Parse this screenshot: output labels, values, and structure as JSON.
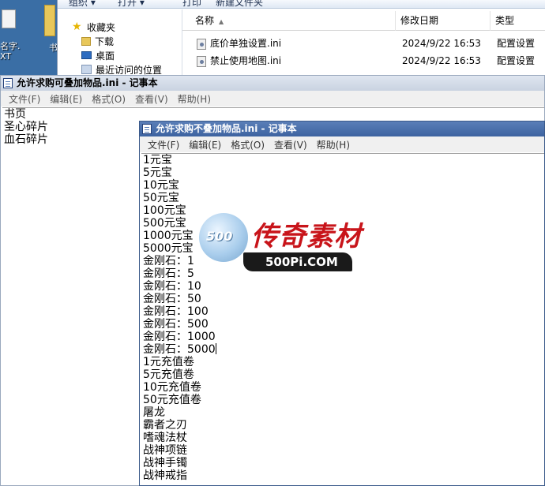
{
  "desktop": {
    "icon_label_line1": "名字.",
    "icon_label_line2": "XT",
    "folder_label": "书"
  },
  "explorer": {
    "toolbar": {
      "organize": "组织 ▾",
      "open": "打开 ▾",
      "print": "打印",
      "new_folder": "新建文件夹"
    },
    "nav": [
      {
        "label": "收藏夹",
        "icon": "star-icon"
      },
      {
        "label": "下载",
        "icon": "download-folder-icon"
      },
      {
        "label": "桌面",
        "icon": "desktop-icon"
      },
      {
        "label": "最近访问的位置",
        "icon": "recent-places-icon"
      }
    ],
    "columns": {
      "name": "名称",
      "date": "修改日期",
      "type": "类型"
    },
    "files": [
      {
        "name": "底价单独设置.ini",
        "date": "2024/9/22 16:53",
        "type": "配置设置"
      },
      {
        "name": "禁止使用地图.ini",
        "date": "2024/9/22 16:53",
        "type": "配置设置"
      }
    ]
  },
  "notepad_back": {
    "title": "允许求购可叠加物品.ini - 记事本",
    "menu": [
      "文件(F)",
      "编辑(E)",
      "格式(O)",
      "查看(V)",
      "帮助(H)"
    ],
    "lines": [
      "书页",
      "圣心碎片",
      "血石碎片"
    ]
  },
  "notepad_front": {
    "title": "允许求购不叠加物品.ini - 记事本",
    "menu": [
      "文件(F)",
      "编辑(E)",
      "格式(O)",
      "查看(V)",
      "帮助(H)"
    ],
    "lines": [
      "1元宝",
      "5元宝",
      "10元宝",
      "50元宝",
      "100元宝",
      "500元宝",
      "1000元宝",
      "5000元宝",
      "金刚石：1",
      "金刚石：5",
      "金刚石：10",
      "金刚石：50",
      "金刚石：100",
      "金刚石：500",
      "金刚石：1000",
      "金刚石：5000",
      "1元充值卷",
      "5元充值卷",
      "10元充值卷",
      "50元充值卷",
      "屠龙",
      "霸者之刃",
      "嗜魂法杖",
      "战神项链",
      "战神手镯",
      "战神戒指"
    ]
  },
  "watermark": {
    "globe_text": "500",
    "chinese": "传奇素材",
    "english": "500Pi.COM"
  }
}
